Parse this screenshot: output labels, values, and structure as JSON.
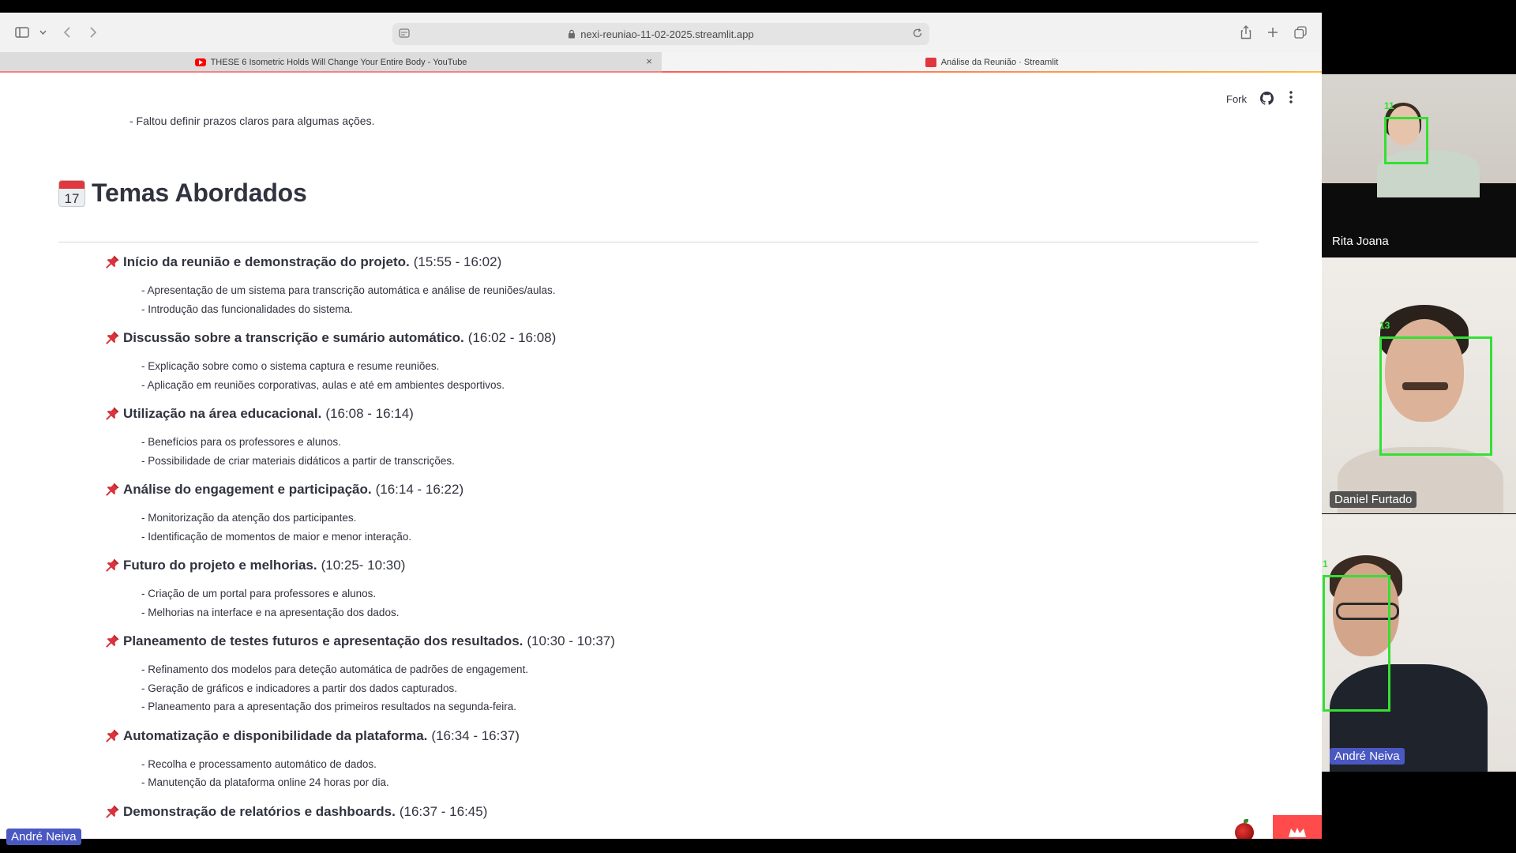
{
  "browser": {
    "address": "nexi-reuniao-11-02-2025.streamlit.app",
    "tabs": [
      {
        "title": "THESE 6 Isometric Holds Will Change Your Entire Body - YouTube"
      },
      {
        "title": "Análise da Reunião · Streamlit"
      }
    ],
    "close_glyph": "×"
  },
  "streamlit": {
    "fork_label": "Fork",
    "previous_line": "- Faltou definir prazos claros para algumas ações.",
    "calendar_day": "17",
    "heading": "Temas Abordados",
    "topics": [
      {
        "title": "Início da reunião e demonstração do projeto.",
        "time": "(15:55 - 16:02)",
        "bullets": [
          "- Apresentação de um sistema para transcrição automática e análise de reuniões/aulas.",
          "- Introdução das funcionalidades do sistema."
        ]
      },
      {
        "title": "Discussão sobre a transcrição e sumário automático.",
        "time": "(16:02 - 16:08)",
        "bullets": [
          "- Explicação sobre como o sistema captura e resume reuniões.",
          "- Aplicação em reuniões corporativas, aulas e até em ambientes desportivos."
        ]
      },
      {
        "title": "Utilização na área educacional.",
        "time": "(16:08 - 16:14)",
        "bullets": [
          "- Benefícios para os professores e alunos.",
          "- Possibilidade de criar materiais didáticos a partir de transcrições."
        ]
      },
      {
        "title": "Análise do engagement e participação.",
        "time": "(16:14 - 16:22)",
        "bullets": [
          "- Monitorização da atenção dos participantes.",
          "- Identificação de momentos de maior e menor interação."
        ]
      },
      {
        "title": "Futuro do projeto e melhorias.",
        "time": "(10:25- 10:30)",
        "bullets": [
          "- Criação de um portal para professores e alunos.",
          "- Melhorias na interface e na apresentação dos dados."
        ]
      },
      {
        "title": "Planeamento de testes futuros e apresentação dos resultados.",
        "time": "(10:30 - 10:37)",
        "bullets": [
          "- Refinamento dos modelos para deteção automática de padrões de engagement.",
          "- Geração de gráficos e indicadores a partir dos dados capturados.",
          "- Planeamento para a apresentação dos primeiros resultados na segunda-feira."
        ]
      },
      {
        "title": "Automatização e disponibilidade da plataforma.",
        "time": "(16:34 - 16:37)",
        "bullets": [
          "- Recolha e processamento automático de dados.",
          "- Manutenção da plataforma online 24 horas por dia."
        ]
      },
      {
        "title": "Demonstração de relatórios e dashboards.",
        "time": "(16:37 - 16:45)",
        "bullets": []
      }
    ]
  },
  "participants": [
    {
      "name": "Rita Joana",
      "face_id": "11"
    },
    {
      "name": "Daniel Furtado",
      "face_id": "13"
    },
    {
      "name": "André Neiva",
      "face_id": "1"
    }
  ],
  "presenter_label": "André Neiva",
  "colors": {
    "streamlit_red": "#ff4b4b",
    "face_box": "#33e033",
    "name_tag_blue": "#4a58c2",
    "text": "#31333f"
  }
}
